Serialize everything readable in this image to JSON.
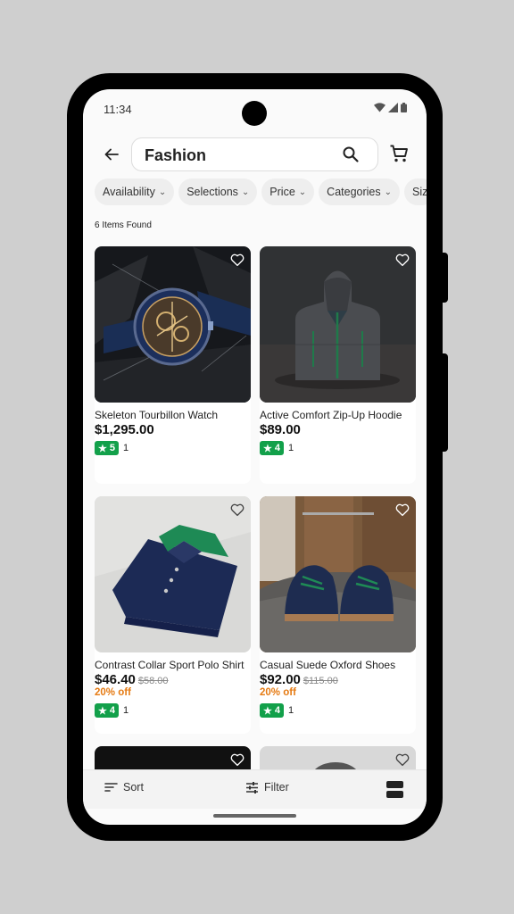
{
  "status_bar": {
    "time": "11:34"
  },
  "header": {
    "search_value": "Fashion"
  },
  "filters": [
    {
      "label": "Availability"
    },
    {
      "label": "Selections"
    },
    {
      "label": "Price"
    },
    {
      "label": "Categories"
    },
    {
      "label": "Siz"
    }
  ],
  "results": {
    "count_text": "6 Items Found"
  },
  "products": [
    {
      "name": "Skeleton Tourbillon Watch",
      "price": "$1,295.00",
      "old_price": "",
      "discount": "",
      "rating": "5",
      "reviews": "1"
    },
    {
      "name": "Active Comfort Zip-Up Hoodie",
      "price": "$89.00",
      "old_price": "",
      "discount": "",
      "rating": "4",
      "reviews": "1"
    },
    {
      "name": "Contrast Collar Sport Polo Shirt",
      "price": "$46.40",
      "old_price": "$58.00",
      "discount": "20% off",
      "rating": "4",
      "reviews": "1"
    },
    {
      "name": "Casual Suede Oxford Shoes",
      "price": "$92.00",
      "old_price": "$115.00",
      "discount": "20% off",
      "rating": "4",
      "reviews": "1"
    }
  ],
  "bottom_bar": {
    "sort_label": "Sort",
    "filter_label": "Filter"
  },
  "colors": {
    "rating_badge": "#12a04a",
    "discount": "#e57a12",
    "background": "#fafafa"
  },
  "icons": [
    "back-arrow-icon",
    "search-icon",
    "cart-icon",
    "chevron-down-icon",
    "heart-icon",
    "star-icon",
    "sort-icon",
    "filter-icon",
    "layout-toggle-icon"
  ]
}
